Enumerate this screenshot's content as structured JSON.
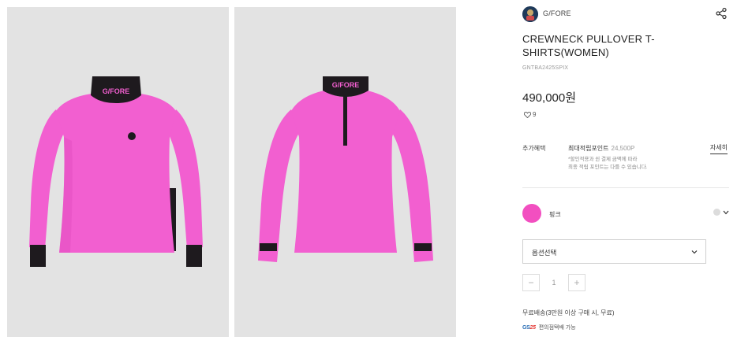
{
  "gallery": {
    "front_image_alt": "front-view",
    "back_image_alt": "back-view",
    "neckband_text": "G/FORE",
    "colors": {
      "body": "#f25fd0",
      "shade": "#e14ec0",
      "trim": "#1e1a1e"
    }
  },
  "brand": {
    "name": "G/FORE",
    "logo_icon": "brand-logo-icon",
    "share_icon": "share-icon"
  },
  "product": {
    "title": "CREWNECK PULLOVER T-SHIRTS(WOMEN)",
    "sku": "GNTBA2425SPIX",
    "price": "490,000원",
    "wish_count": "9"
  },
  "benefit": {
    "label": "추가혜택",
    "title": "최대적립포인트",
    "points": "24,500P",
    "detail_link": "자세히",
    "note_line1": "*할인적용과 쉰 결제 금액에 따라",
    "note_line2": "최종 적립 포인트는 다를 수 있습니다."
  },
  "color": {
    "name": "핑크",
    "swatch": "#f24fc0"
  },
  "options": {
    "select_label": "옵션선택"
  },
  "quantity": {
    "minus": "−",
    "value": "1",
    "plus": "+"
  },
  "shipping": {
    "text": "무료배송(3만원 이상 구매 시, 무료)",
    "cvs_logo_a": "GS",
    "cvs_logo_b": "25",
    "cvs_text": "편의점택배 가능"
  }
}
